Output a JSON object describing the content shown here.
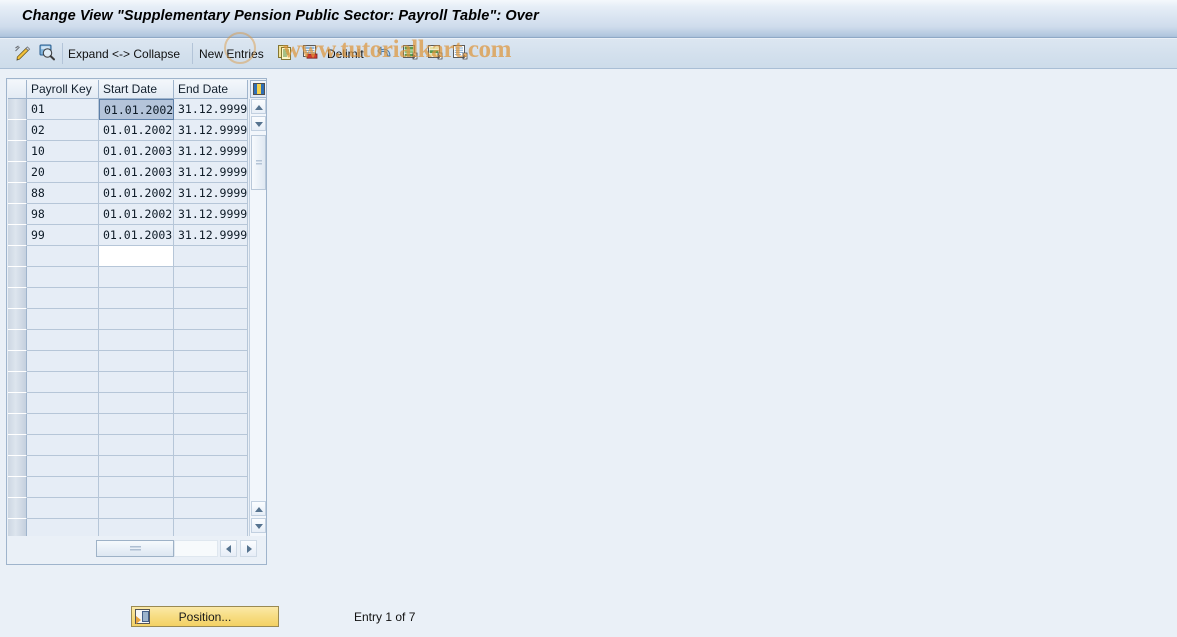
{
  "window": {
    "title": "Change View \"Supplementary Pension Public Sector: Payroll Table\": Over"
  },
  "toolbar": {
    "icons": [
      {
        "name": "display-change-icon",
        "glyph": "pencil"
      },
      {
        "name": "check-entries-icon",
        "glyph": "magnifier"
      }
    ],
    "expand_collapse_label": "Expand <-> Collapse",
    "new_entries_label": "New Entries",
    "copy_as_label": "",
    "delete_label": "",
    "delimit_label": "Delimit",
    "undo_label": "",
    "select_all_label": "",
    "select_block_label": "",
    "deselect_all_label": ""
  },
  "table": {
    "columns": [
      "",
      "Payroll Key",
      "Start Date",
      "End Date"
    ],
    "column_config_icon": "column-settings-icon",
    "rows": [
      {
        "key": "01",
        "start": "01.01.2002",
        "end": "31.12.9999",
        "selected_cell": "start"
      },
      {
        "key": "02",
        "start": "01.01.2002",
        "end": "31.12.9999",
        "selected_cell": ""
      },
      {
        "key": "10",
        "start": "01.01.2003",
        "end": "31.12.9999",
        "selected_cell": ""
      },
      {
        "key": "20",
        "start": "01.01.2003",
        "end": "31.12.9999",
        "selected_cell": ""
      },
      {
        "key": "88",
        "start": "01.01.2002",
        "end": "31.12.9999",
        "selected_cell": ""
      },
      {
        "key": "98",
        "start": "01.01.2002",
        "end": "31.12.9999",
        "selected_cell": ""
      },
      {
        "key": "99",
        "start": "01.01.2003",
        "end": "31.12.9999",
        "selected_cell": ""
      }
    ],
    "empty_row_count": 15,
    "white_empty_start_cell_row": 0
  },
  "footer": {
    "position_button_label": "Position...",
    "entry_status": "Entry 1 of 7"
  },
  "watermark": {
    "text": "www.tutorialkart.com"
  },
  "colors": {
    "title_bar_top": "#f4f8fc",
    "title_bar_bottom": "#aec4dd",
    "toolbar": "#d3e0ed",
    "page_background": "#eaf0f7",
    "cell_background": "#e6edf6",
    "selected_cell": "#b4c4da",
    "button_yellow": "#f7dd84",
    "watermark": "#de963c"
  }
}
